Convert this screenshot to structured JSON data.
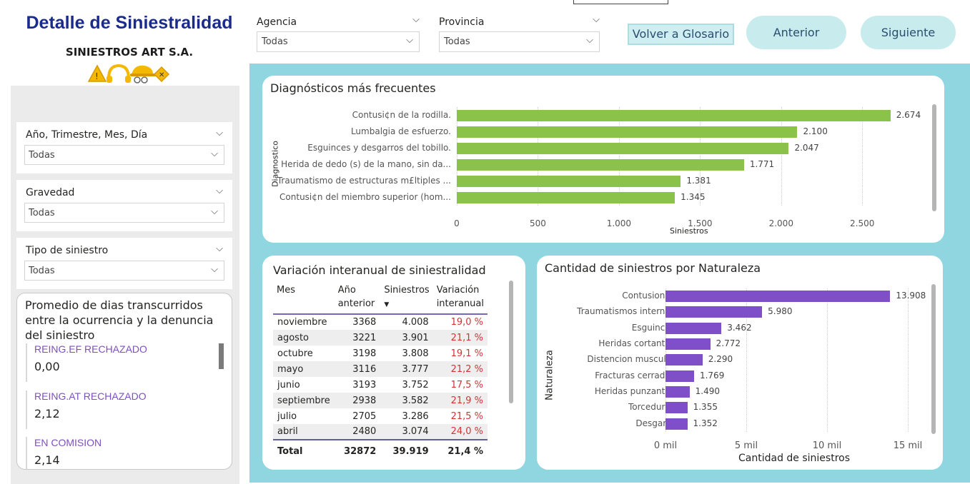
{
  "header": {
    "title": "Detalle de Siniestralidad",
    "company": "SINIESTROS ART S.A.",
    "agencia": {
      "label": "Agencia",
      "value": "Todas"
    },
    "provincia": {
      "label": "Provincia",
      "value": "Todas"
    },
    "btn_glosario": "Volver a Glosario",
    "btn_anterior": "Anterior",
    "btn_siguiente": "Siguiente"
  },
  "slicers": {
    "fecha": {
      "label": "Año, Trimestre, Mes, Día",
      "value": "Todas"
    },
    "gravedad": {
      "label": "Gravedad",
      "value": "Todas"
    },
    "tipo": {
      "label": "Tipo de siniestro",
      "value": "Todas"
    }
  },
  "kpi_card": {
    "title": "Promedio de dias transcurridos entre la ocurrencia y la denuncia del siniestro",
    "items": [
      {
        "label": "REING.EF RECHAZADO",
        "value": "0,00"
      },
      {
        "label": "REING.AT RECHAZADO",
        "value": "2,12"
      },
      {
        "label": "EN COMISION",
        "value": "2,14"
      }
    ]
  },
  "diagnosticos": {
    "title": "Diagnósticos más frecuentes",
    "ylabel": "Diagnostico",
    "xlabel": "Siniestros",
    "bar_color": "#8bc34a",
    "xticks": [
      "0",
      "500",
      "1.000",
      "1.500",
      "2.000",
      "2.500"
    ],
    "labels": [
      "2.674",
      "2.100",
      "2.047",
      "1.771",
      "1.381",
      "1.345"
    ]
  },
  "naturaleza": {
    "title": "Cantidad de siniestros por Naturaleza",
    "ylabel": "Naturaleza",
    "xlabel": "Cantidad de siniestros",
    "bar_color": "#7e4fc9",
    "xticks": [
      "0 mil",
      "5 mil",
      "10 mil",
      "15 mil"
    ],
    "labels": [
      "13.908",
      "5.980",
      "3.462",
      "2.772",
      "2.290",
      "1.769",
      "1.490",
      "1.355",
      "1.352"
    ]
  },
  "variacion": {
    "title": "Variación interanual de siniestralidad",
    "columns": [
      "Mes",
      "Año anterior",
      "Siniestros",
      "Variación interanual"
    ],
    "rows": [
      {
        "mes": "noviembre",
        "anterior": "3368",
        "siniestros": "4.008",
        "var": "19,0 %"
      },
      {
        "mes": "agosto",
        "anterior": "3221",
        "siniestros": "3.901",
        "var": "21,1 %"
      },
      {
        "mes": "octubre",
        "anterior": "3198",
        "siniestros": "3.808",
        "var": "19,1 %"
      },
      {
        "mes": "mayo",
        "anterior": "3116",
        "siniestros": "3.777",
        "var": "21,2 %"
      },
      {
        "mes": "junio",
        "anterior": "3193",
        "siniestros": "3.752",
        "var": "17,5 %"
      },
      {
        "mes": "septiembre",
        "anterior": "2938",
        "siniestros": "3.582",
        "var": "21,9 %"
      },
      {
        "mes": "julio",
        "anterior": "2705",
        "siniestros": "3.286",
        "var": "21,5 %"
      },
      {
        "mes": "abril",
        "anterior": "2480",
        "siniestros": "3.074",
        "var": "24,0 %"
      }
    ],
    "total": {
      "mes": "Total",
      "anterior": "32872",
      "siniestros": "39.919",
      "var": "21,4 %"
    }
  },
  "chart_data": [
    {
      "type": "bar",
      "orientation": "horizontal",
      "title": "Diagnósticos más frecuentes",
      "xlabel": "Siniestros",
      "ylabel": "Diagnostico",
      "categories": [
        "Contusi¢n de la rodilla.",
        "Lumbalgia de esfuerzo.",
        "Esguinces y desgarros del tobillo.",
        "Herida de dedo (s) de la mano, sin da...",
        "Traumatismo de estructuras m£ltiples ...",
        "Contusi¢n del miembro superior (hom..."
      ],
      "values": [
        2674,
        2100,
        2047,
        1771,
        1381,
        1345
      ],
      "xlim": [
        0,
        2900
      ]
    },
    {
      "type": "bar",
      "orientation": "horizontal",
      "title": "Cantidad de siniestros por Naturaleza",
      "xlabel": "Cantidad de siniestros",
      "ylabel": "Naturaleza",
      "categories": [
        "Contusiones",
        "Traumatismos internos",
        "Esguinces",
        "Heridas cortantes",
        "Distencion muscular",
        "Fracturas cerradas",
        "Heridas punzantes",
        "Torceduras",
        "Desgarro"
      ],
      "values": [
        13908,
        5980,
        3462,
        2772,
        2290,
        1769,
        1490,
        1355,
        1352
      ],
      "xlim": [
        0,
        15000
      ]
    }
  ]
}
